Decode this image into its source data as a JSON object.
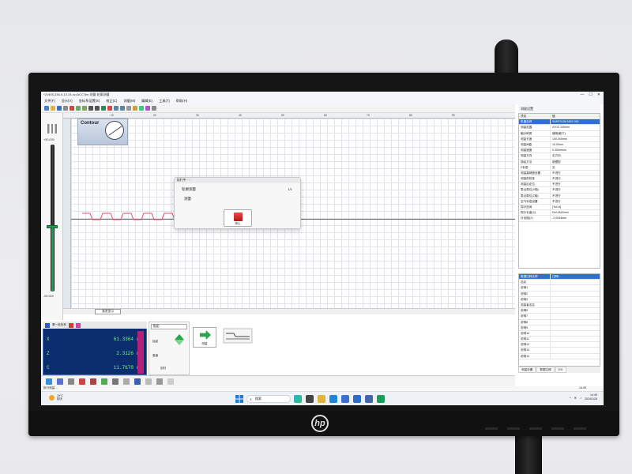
{
  "window": {
    "title": "*21905-236-5-10.24.ccl  ACCTee  测量 轮廓测量",
    "controls": [
      "—",
      "☐",
      "✕"
    ]
  },
  "menu": [
    "文件(F)",
    "显示(V)",
    "坐标系设置(S)",
    "校正(C)",
    "测量(M)",
    "编辑(E)",
    "工具(T)",
    "帮助(H)"
  ],
  "canvas": {
    "contour_label": "Contour",
    "ruler_ticks": [
      "10",
      "20",
      "30",
      "40",
      "50",
      "60",
      "70",
      "80",
      "90"
    ],
    "scale_top": "+50.000",
    "scale_bottom": "-50.000",
    "view_select": "渐进显示"
  },
  "dialog": {
    "title": "执行中 · · ·",
    "name": "轮廓测量",
    "count": "1/1",
    "status": "测量",
    "stop_label": "停止"
  },
  "properties": {
    "panel_title": "测量设置",
    "header": [
      "项目",
      "值"
    ],
    "rows": [
      {
        "k": "机器名称",
        "v": "SURFCOM NEX 030"
      },
      {
        "k": "测量范围",
        "v": "X/Y/Z 100mm"
      },
      {
        "k": "触针种类",
        "v": "通常(触下)"
      },
      {
        "k": "测量长度",
        "v": "100.000mm"
      },
      {
        "k": "测量间距",
        "v": "10.00um"
      },
      {
        "k": "测量速度",
        "v": "0.300mm/s"
      },
      {
        "k": "测量方向",
        "v": "右方向"
      },
      {
        "k": "描绘方法",
        "v": "钢锯型"
      },
      {
        "k": "Z补偿",
        "v": "无"
      },
      {
        "k": "测量高精度设置",
        "v": "不进行"
      },
      {
        "k": "测量前校准",
        "v": "不进行"
      },
      {
        "k": "测量后定位",
        "v": "不进行"
      },
      {
        "k": "零点原位(X轴)",
        "v": "不进行"
      },
      {
        "k": "零点原位(Z轴)",
        "v": "不进行"
      },
      {
        "k": "空气补偿设置",
        "v": "不进行"
      },
      {
        "k": "探针选用",
        "v": "[ToCol]"
      },
      {
        "k": "探针长度(X)",
        "v": "Def.4620mm"
      },
      {
        "k": "针径值(X)",
        "v": "-2.0044mm"
      }
    ]
  },
  "comments": {
    "header": [
      "数据注释名称",
      "注释1"
    ],
    "rows": [
      "品名",
      "说明1",
      "说明2",
      "说明3",
      "测量者名名",
      "说明5",
      "说明7",
      "说明8",
      "说明9",
      "说明10",
      "说明11",
      "说明12",
      "说明13",
      "说明14"
    ],
    "tabs": [
      "测量设置",
      "数据注释",
      "EXI"
    ]
  },
  "coords": {
    "head_tabs": [
      "",
      "第一坐标系",
      "",
      ""
    ],
    "rows": [
      {
        "axis": "X",
        "value": "61.3364",
        "unit": "mm"
      },
      {
        "axis": "Z",
        "value": "2.3126",
        "unit": "mm"
      },
      {
        "axis": "C",
        "value": "11.7678",
        "unit": "mm"
      }
    ]
  },
  "controls": {
    "mode_select": "粗定",
    "btn_a": "抬起",
    "btn_b": "高速",
    "btn_c": "回归",
    "measure_label": "测量"
  },
  "status": {
    "left": "执行测量 ...",
    "time": "14:49"
  },
  "taskbar": {
    "weather_temp": "19°C",
    "weather_desc": "阴天",
    "search_placeholder": "搜索",
    "clock_time": "14:49",
    "clock_date": "2024/1/26"
  },
  "colors": {
    "coord_bg": "#0b2d6e",
    "coord_text": "#7cf08a",
    "wave": "#e0506a",
    "stop": "#d32424",
    "measure": "#2aa54d"
  }
}
